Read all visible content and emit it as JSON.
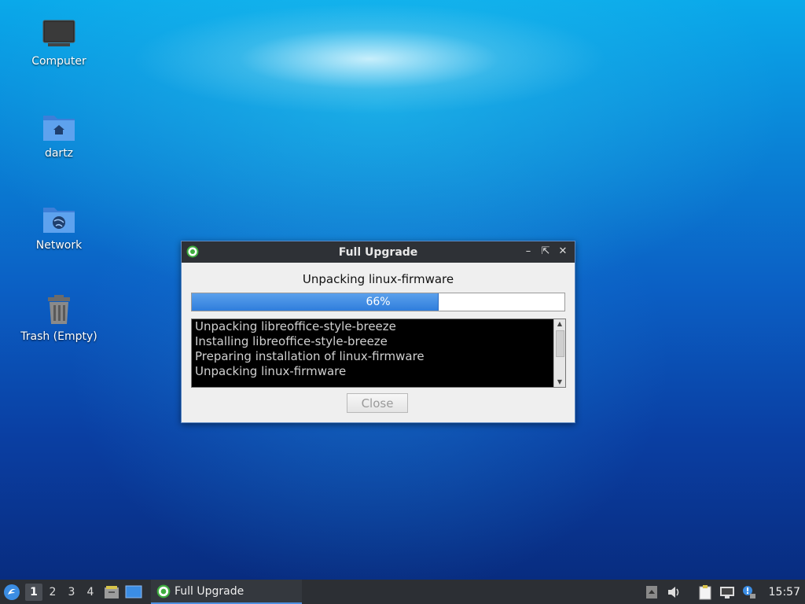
{
  "desktop": {
    "icons": [
      {
        "label": "Computer"
      },
      {
        "label": "dartz"
      },
      {
        "label": "Network"
      },
      {
        "label": "Trash (Empty)"
      }
    ]
  },
  "dialog": {
    "title": "Full Upgrade",
    "status": "Unpacking linux-firmware",
    "progress": {
      "value": 66,
      "label": "66%"
    },
    "log_lines": [
      "Unpacking libreoffice-style-breeze",
      "Installing libreoffice-style-breeze",
      "Preparing installation of linux-firmware",
      "Unpacking linux-firmware"
    ],
    "close_label": "Close"
  },
  "taskbar": {
    "workspaces": [
      "1",
      "2",
      "3",
      "4"
    ],
    "active_workspace": "1",
    "task_label": "Full Upgrade",
    "clock": "15:57"
  },
  "colors": {
    "accent": "#2f7ddc",
    "panel": "#2c2f34",
    "titlebar": "#2e3136"
  }
}
